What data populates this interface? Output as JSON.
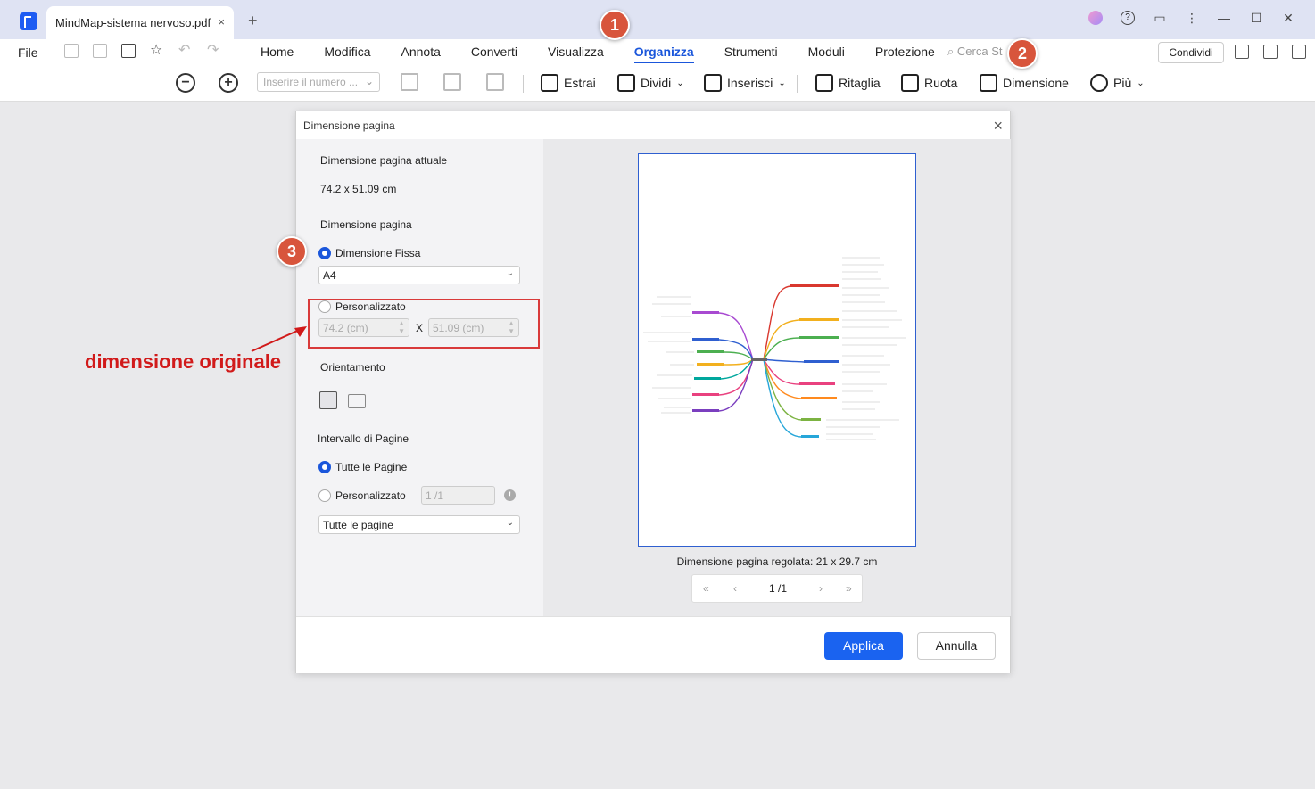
{
  "window": {
    "tab_title": "MindMap-sistema nervoso.pdf",
    "tab_close": "×",
    "new_tab": "+"
  },
  "menubar": {
    "file": "File",
    "items": [
      "Home",
      "Modifica",
      "Annota",
      "Converti",
      "Visualizza",
      "Organizza",
      "Strumenti",
      "Moduli",
      "Protezione"
    ],
    "active": "Organizza",
    "search_placeholder": "Cerca St",
    "share": "Condividi"
  },
  "toolbar": {
    "page_input_placeholder": "Inserire il numero ...",
    "extract": "Estrai",
    "split": "Dividi",
    "insert": "Inserisci",
    "crop": "Ritaglia",
    "rotate": "Ruota",
    "size": "Dimensione",
    "more": "Più"
  },
  "dialog": {
    "title": "Dimensione pagina",
    "current_size_label": "Dimensione pagina attuale",
    "current_size_value": "74.2 x 51.09 cm",
    "page_size_label": "Dimensione pagina",
    "fixed_size": "Dimensione Fissa",
    "fixed_option": "A4",
    "custom": "Personalizzato",
    "custom_width": "74.2 (cm)",
    "custom_height": "51.09 (cm)",
    "times": "X",
    "orientation_label": "Orientamento",
    "range_label": "Intervallo di Pagine",
    "all_pages": "Tutte le Pagine",
    "custom_range": "Personalizzato",
    "custom_range_value": "1 /1",
    "page_subset": "Tutte le pagine",
    "adjusted_size": "Dimensione pagina regolata: 21 x 29.7 cm",
    "pager_current": "1 /1",
    "apply": "Applica",
    "cancel": "Annulla"
  },
  "annotations": {
    "step1": "1",
    "step2": "2",
    "step3": "3",
    "note": "dimensione originale",
    "color": "#d11a1a"
  },
  "colors": {
    "accent": "#1a56db",
    "step_badge": "#d8553c"
  }
}
